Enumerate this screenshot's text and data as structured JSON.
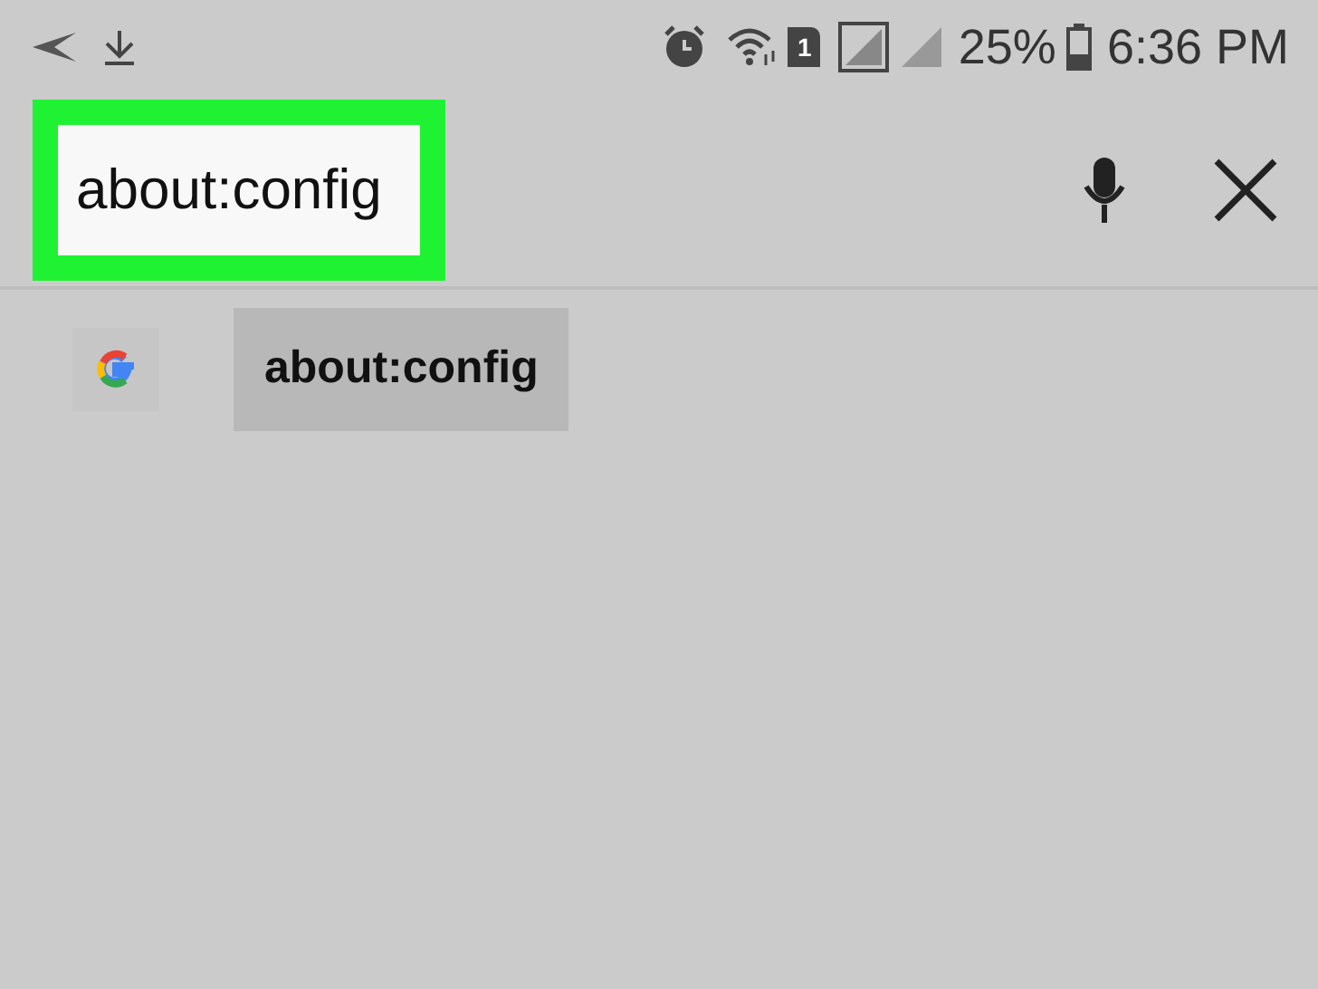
{
  "status_bar": {
    "battery": "25%",
    "time": "6:36 PM",
    "sim_slot": "1"
  },
  "search": {
    "value": "about:config",
    "highlighted": true
  },
  "suggestions": [
    {
      "text": "about:config",
      "selected": true
    }
  ]
}
